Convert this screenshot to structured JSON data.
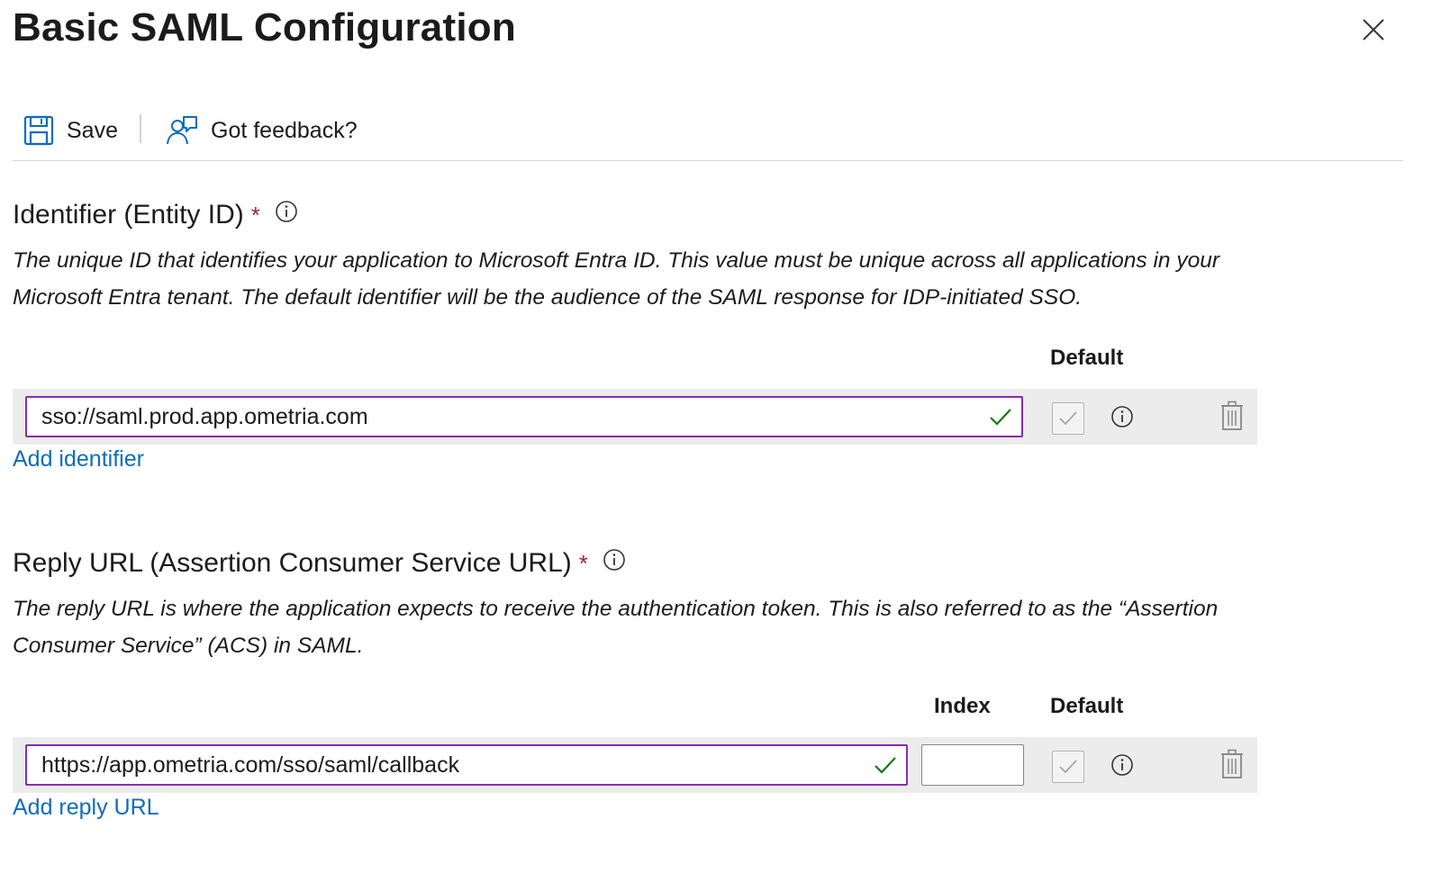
{
  "header": {
    "title": "Basic SAML Configuration",
    "close_icon": "close-icon"
  },
  "toolbar": {
    "save_label": "Save",
    "save_icon": "save-icon",
    "feedback_label": "Got feedback?",
    "feedback_icon": "feedback-icon"
  },
  "identifier": {
    "title": "Identifier (Entity ID)",
    "required_mark": "*",
    "description_line1": "The unique ID that identifies your application to Microsoft Entra ID. This value must be unique across all applications in your",
    "description_line2": "Microsoft Entra tenant. The default identifier will be the audience of the SAML response for IDP-initiated SSO.",
    "default_header": "Default",
    "value": "sso://saml.prod.app.ometria.com",
    "default_checked": true,
    "add_link": "Add identifier"
  },
  "reply_url": {
    "title": "Reply URL (Assertion Consumer Service URL)",
    "required_mark": "*",
    "description_line1": "The reply URL is where the application expects to receive the authentication token. This is also referred to as the “Assertion",
    "description_line2": "Consumer Service” (ACS) in SAML.",
    "index_header": "Index",
    "default_header": "Default",
    "value": "https://app.ometria.com/sso/saml/callback",
    "index_value": "",
    "default_checked": true,
    "add_link": "Add reply URL"
  },
  "colors": {
    "input_border": "#8a2bb3",
    "link": "#0f6cbd",
    "required": "#a4262c",
    "valid_check": "#107c10",
    "row_background": "#ececec"
  }
}
